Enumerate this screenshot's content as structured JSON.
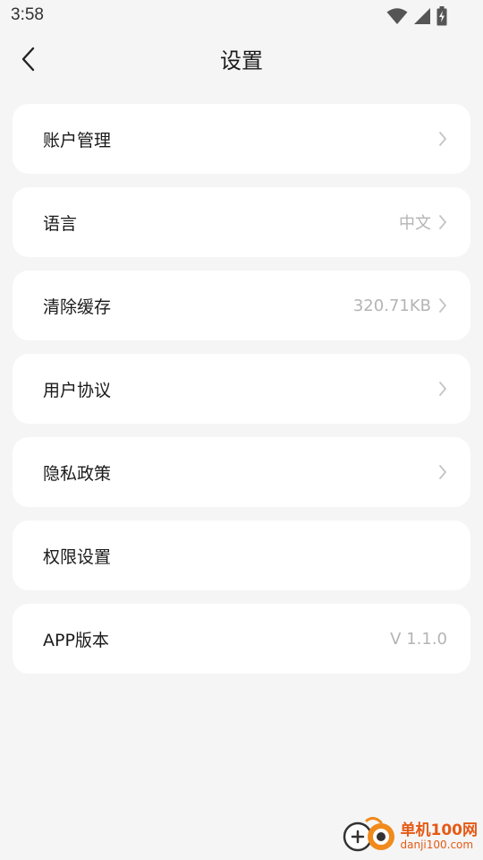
{
  "status_bar": {
    "time": "3:58"
  },
  "header": {
    "title": "设置"
  },
  "settings": [
    {
      "label": "账户管理",
      "value": "",
      "chevron": true
    },
    {
      "label": "语言",
      "value": "中文",
      "chevron": true
    },
    {
      "label": "清除缓存",
      "value": "320.71KB",
      "chevron": true
    },
    {
      "label": "用户协议",
      "value": "",
      "chevron": true
    },
    {
      "label": "隐私政策",
      "value": "",
      "chevron": true
    },
    {
      "label": "权限设置",
      "value": "",
      "chevron": false
    },
    {
      "label": "APP版本",
      "value": "V 1.1.0",
      "chevron": false
    }
  ],
  "watermark": {
    "main": "单机100网",
    "sub": "danji100.com"
  },
  "colors": {
    "background": "#f5f5f5",
    "card": "#ffffff",
    "value_text": "#b4b4b4",
    "watermark": "#e55a16"
  }
}
